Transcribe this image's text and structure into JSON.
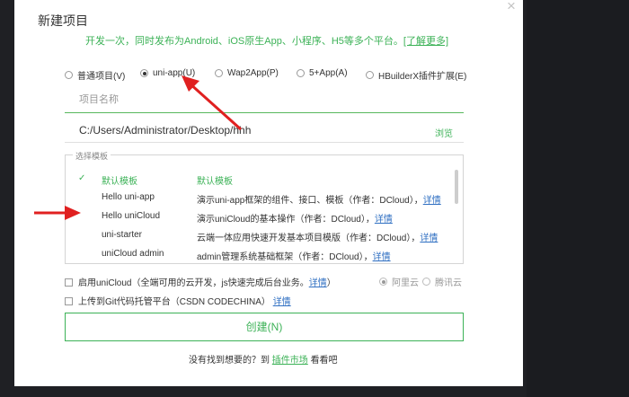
{
  "dialog": {
    "title": "新建项目",
    "subtitle": "开发一次，同时发布为Android、iOS原生App、小程序、H5等多个平台。",
    "learn_more": "[了解更多]",
    "close_glyph": "×"
  },
  "project_types": [
    {
      "label": "普通项目(V)",
      "selected": false
    },
    {
      "label": "uni-app(U)",
      "selected": true
    },
    {
      "label": "Wap2App(P)",
      "selected": false
    },
    {
      "label": "5+App(A)",
      "selected": false
    },
    {
      "label": "HBuilderX插件扩展(E)",
      "selected": false
    }
  ],
  "project_name": {
    "placeholder": "项目名称",
    "value": ""
  },
  "location": {
    "path": "C:/Users/Administrator/Desktop/hhh",
    "browse_label": "浏览"
  },
  "templates": {
    "legend": "选择模板",
    "rows": [
      {
        "name": "默认模板",
        "desc": "默认模板",
        "detail": "",
        "selected": true
      },
      {
        "name": "Hello uni-app",
        "desc": "演示uni-app框架的组件、接口、模板（作者：DCloud），",
        "detail": "详情",
        "selected": false
      },
      {
        "name": "Hello uniCloud",
        "desc": "演示uniCloud的基本操作（作者：DCloud），",
        "detail": "详情",
        "selected": false
      },
      {
        "name": "uni-starter",
        "desc": "云端一体应用快速开发基本项目模版（作者：DCloud），",
        "detail": "详情",
        "selected": false
      },
      {
        "name": "uniCloud admin",
        "desc": "admin管理系统基础框架（作者：DCloud），",
        "detail": "详情",
        "selected": false
      }
    ],
    "check_glyph": "✓"
  },
  "unicloud": {
    "label": "启用uniCloud",
    "note": "（全端可用的云开发，js快速完成后台业务。",
    "detail": "详情",
    "close_paren": "）",
    "checked": false,
    "providers": [
      {
        "label": "阿里云",
        "selected": true
      },
      {
        "label": "腾讯云",
        "selected": false
      }
    ]
  },
  "git_upload": {
    "label": "上传到Git代码托管平台（CSDN CODECHINA）",
    "detail": "详情",
    "checked": false
  },
  "create_button": "创建(N)",
  "footer": {
    "prefix": "没有找到想要的？到",
    "market": "插件市场",
    "suffix": "看看吧"
  },
  "colors": {
    "accent": "#3cb257",
    "link": "#2f6fc2",
    "arrow": "#e02020",
    "backdrop": "#1f2024"
  }
}
